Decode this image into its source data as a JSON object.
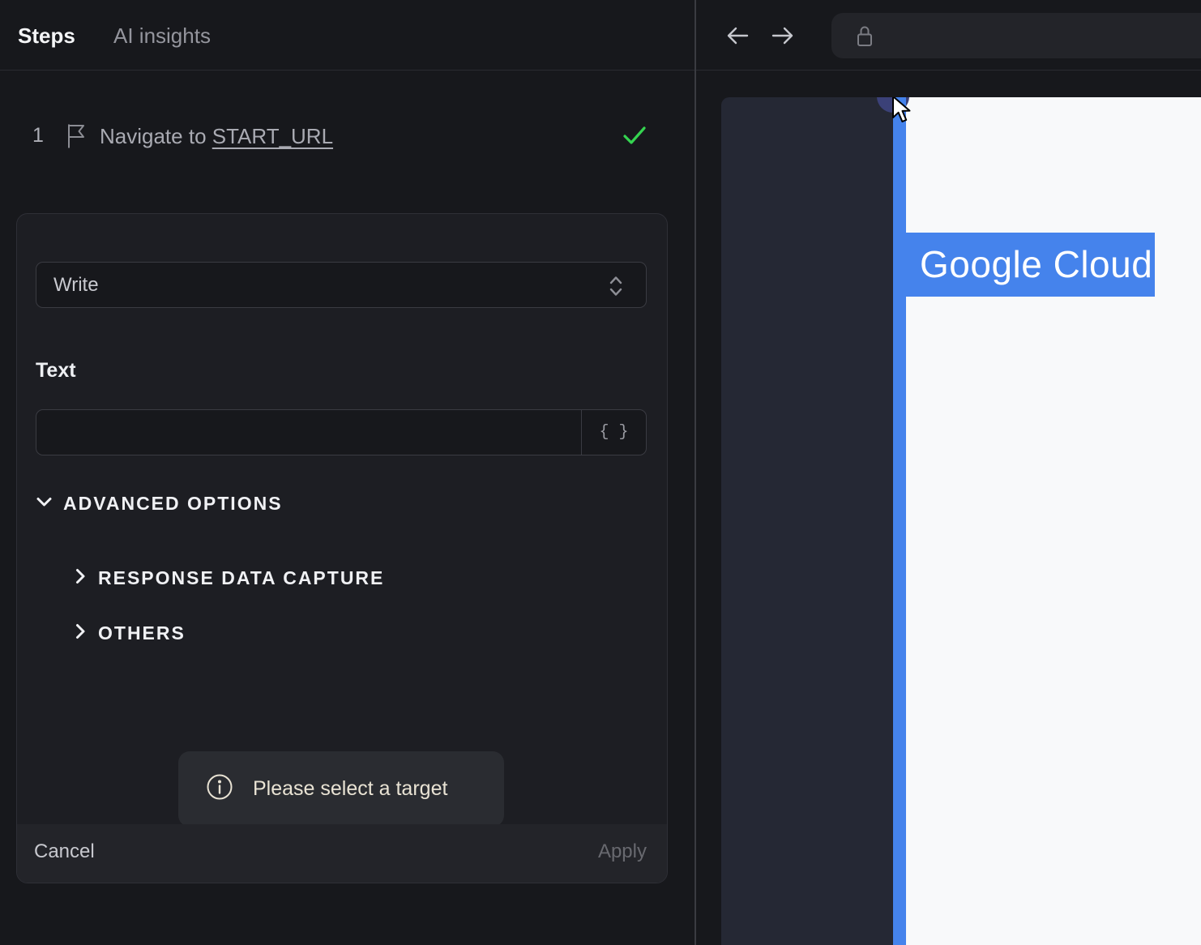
{
  "colors": {
    "accent_blue": "#4583ec",
    "success_green": "#35d450",
    "tooltip_text": "#e9e3d4",
    "panel_bg": "#17181c",
    "preview_sidebar_navy": "#252834"
  },
  "header": {
    "tabs": [
      {
        "label": "Steps",
        "active": true
      },
      {
        "label": "AI insights",
        "active": false
      }
    ]
  },
  "left_panel": {
    "step": {
      "number": "1",
      "action_text": "Navigate to ",
      "target_text": "START_URL",
      "status": "success"
    },
    "editor": {
      "action_select_value": "Write",
      "text_label": "Text",
      "text_value": "",
      "braces_button_label": "{ }",
      "advanced_header": "ADVANCED OPTIONS",
      "sections": [
        {
          "label": "RESPONSE DATA CAPTURE"
        },
        {
          "label": "OTHERS"
        }
      ],
      "tooltip_text": "Please select a target",
      "cancel_label": "Cancel",
      "apply_label": "Apply"
    }
  },
  "browser": {
    "preview": {
      "brand_text": "Google Cloud"
    }
  }
}
